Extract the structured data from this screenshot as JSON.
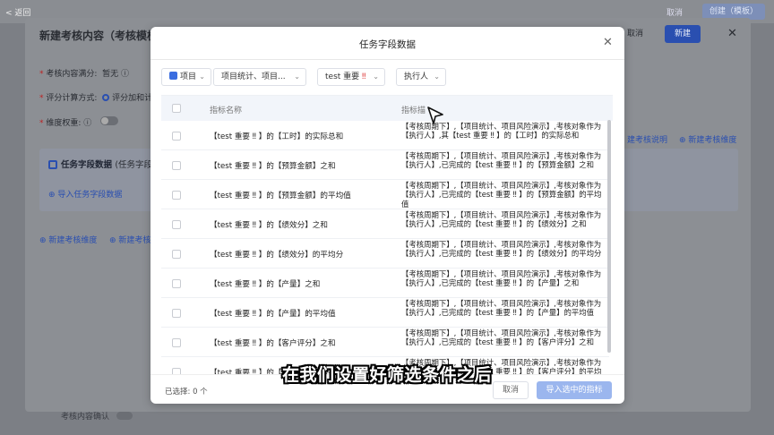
{
  "topbar": {
    "back": "< 返回",
    "cancel": "取消",
    "create": "创建（模板）"
  },
  "panel": {
    "title": "新建考核内容（考核模板",
    "cancel": "取消",
    "confirm": "新建",
    "full_score_label": "考核内容满分:",
    "full_score_value": "暂无",
    "calc_label": "评分计算方式:",
    "calc_value": "评分加和计",
    "weight_label": "维度权重:",
    "field_box_title": "任务字段数据",
    "field_box_note": "(任务字段",
    "import_link": "导入任务字段数据",
    "new_dim_link": "新建考核维度",
    "new_more_link": "新建考核",
    "explain_link": "建考核说明",
    "new_dim_link_right": "新建考核维度",
    "bottom_label": "考核内容确认"
  },
  "modal": {
    "title": "任务字段数据",
    "filters": {
      "project": "项目",
      "scope": "项目统计、项目...",
      "tag": "test 重要",
      "assignee": "执行人"
    },
    "columns": {
      "name": "指标名称",
      "desc": "指标描"
    },
    "rows": [
      {
        "name": "【test 重要 ‼ 】的【工时】的实际总和",
        "desc": "【考核周期下】,【项目统计、项目风险演示】,考核对象作为【执行人】,其【test 重要 ‼ 】的【工时】的实际总和"
      },
      {
        "name": "【test 重要 ‼ 】的【预算金额】之和",
        "desc": "【考核周期下】,【项目统计、项目风险演示】,考核对象作为【执行人】,已完成的【test 重要 ‼ 】的【预算金额】之和"
      },
      {
        "name": "【test 重要 ‼ 】的【预算金额】的平均值",
        "desc": "【考核周期下】,【项目统计、项目风险演示】,考核对象作为【执行人】,已完成的【test 重要 ‼ 】的【预算金额】的平均值"
      },
      {
        "name": "【test 重要 ‼ 】的【绩效分】之和",
        "desc": "【考核周期下】,【项目统计、项目风险演示】,考核对象作为【执行人】,已完成的【test 重要 ‼ 】的【绩效分】之和"
      },
      {
        "name": "【test 重要 ‼ 】的【绩效分】的平均分",
        "desc": "【考核周期下】,【项目统计、项目风险演示】,考核对象作为【执行人】,已完成的【test 重要 ‼ 】的【绩效分】的平均分"
      },
      {
        "name": "【test 重要 ‼ 】的【产量】之和",
        "desc": "【考核周期下】,【项目统计、项目风险演示】,考核对象作为【执行人】,已完成的【test 重要 ‼ 】的【产量】之和"
      },
      {
        "name": "【test 重要 ‼ 】的【产量】的平均值",
        "desc": "【考核周期下】,【项目统计、项目风险演示】,考核对象作为【执行人】,已完成的【test 重要 ‼ 】的【产量】的平均值"
      },
      {
        "name": "【test 重要 ‼ 】的【客户评分】之和",
        "desc": "【考核周期下】,【项目统计、项目风险演示】,考核对象作为【执行人】,已完成的【test 重要 ‼ 】的【客户评分】之和"
      },
      {
        "name": "【test 重要 ‼ 】的【客户评分】的平均值",
        "desc": "【考核周期下】,【项目统计、项目风险演示】,考核对象作为【执行人】,已完成的【test 重要 ‼ 】的【客户评分】的平均值"
      }
    ],
    "selected_count": "已选择: 0 个",
    "cancel": "取消",
    "import_selected": "导入选中的指标"
  },
  "subtitle": "在我们设置好筛选条件之后",
  "colors": {
    "accent": "#3a6de0",
    "primary_disabled": "#9bb6ee"
  }
}
